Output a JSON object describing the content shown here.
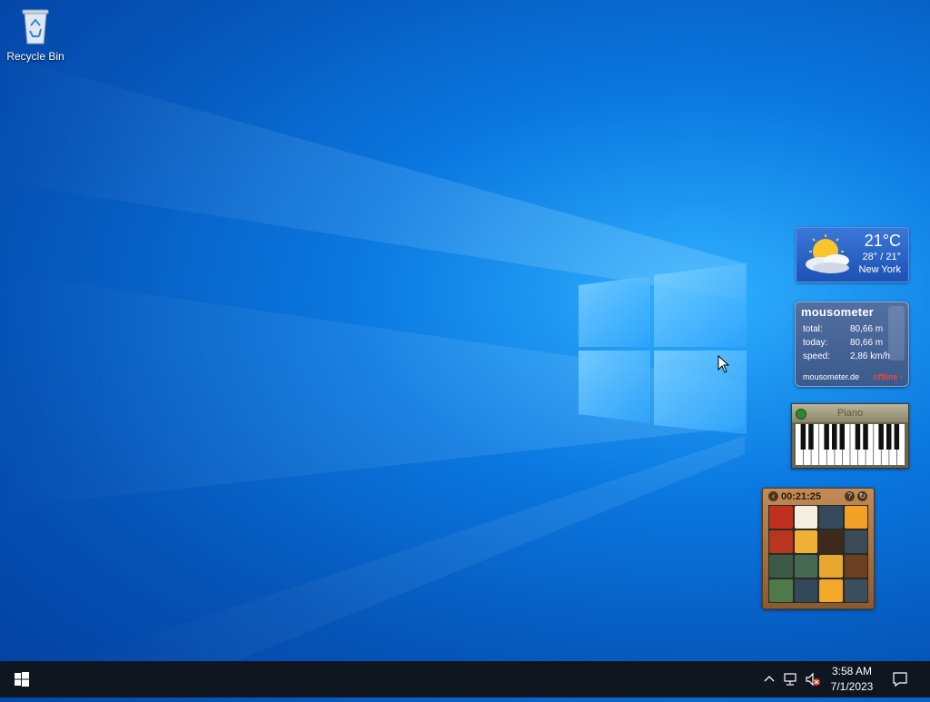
{
  "desktop": {
    "icons": [
      {
        "label": "Recycle Bin",
        "icon": "recycle-bin-icon"
      }
    ]
  },
  "weather_gadget": {
    "temperature": "21°C",
    "range": "28° / 21°",
    "city": "New York",
    "icon": "partly-sunny-icon"
  },
  "mousometer": {
    "title": "mousometer",
    "rows": [
      {
        "label": "total:",
        "value": "80,66 m"
      },
      {
        "label": "today:",
        "value": "80,66 m"
      },
      {
        "label": "speed:",
        "value": "2,86 km/h"
      }
    ],
    "site": "mousometer.de",
    "status": "offline ›"
  },
  "piano_gadget": {
    "title": "Piano"
  },
  "puzzle_gadget": {
    "time": "00:21:25",
    "left_button": "‹",
    "help_button": "?",
    "restart_button": "↻"
  },
  "taskbar": {
    "clock_time": "3:58 AM",
    "clock_date": "7/1/2023",
    "tray_icons": [
      "chevron-up-icon",
      "network-icon",
      "volume-muted-icon"
    ]
  },
  "colors": {
    "taskbar": "#0f1620",
    "desktop_accent": "#0a78e0",
    "mousometer_offline": "#e74a3a"
  }
}
